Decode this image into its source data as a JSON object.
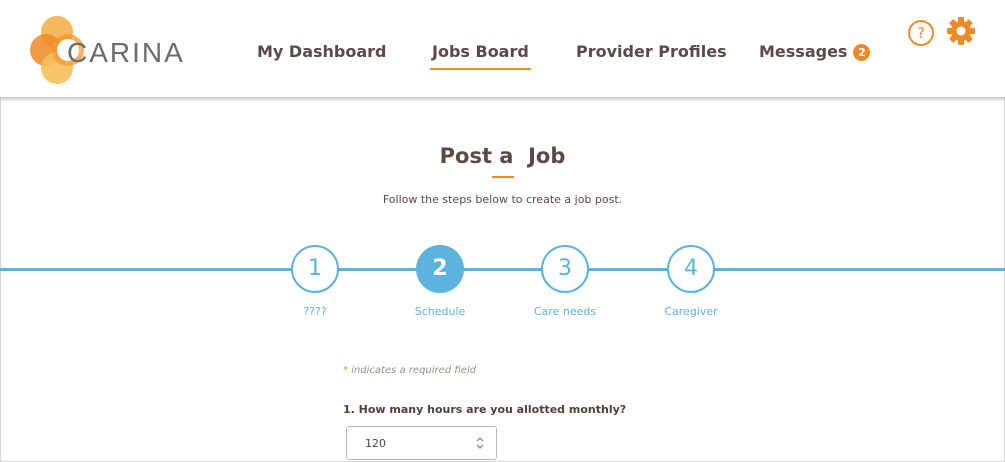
{
  "app": {
    "logo_text": "CARINA"
  },
  "nav": {
    "items": [
      {
        "label": "My Dashboard"
      },
      {
        "label": "Jobs Board"
      },
      {
        "label": "Provider Profiles"
      },
      {
        "label": "Messages",
        "badge": "2"
      }
    ],
    "active": "Jobs Board",
    "help_icon": "question-circle-icon",
    "settings_icon": "gear-icon"
  },
  "page": {
    "title": "Post a  Job",
    "subtitle": "Follow the steps below to create a job post."
  },
  "steps": [
    {
      "number": "1",
      "label": "????"
    },
    {
      "number": "2",
      "label": "Schedule"
    },
    {
      "number": "3",
      "label": "Care needs"
    },
    {
      "number": "4",
      "label": "Caregiver"
    }
  ],
  "current_step": "2",
  "form": {
    "required_star": "*",
    "required_note": "indicates a required field",
    "question_1": "1. How many hours are you allotted monthly?",
    "hours_value": "120"
  },
  "colors": {
    "accent": "#f08a24",
    "step_blue": "#5ab4de",
    "text_brown": "#5b4a44"
  }
}
